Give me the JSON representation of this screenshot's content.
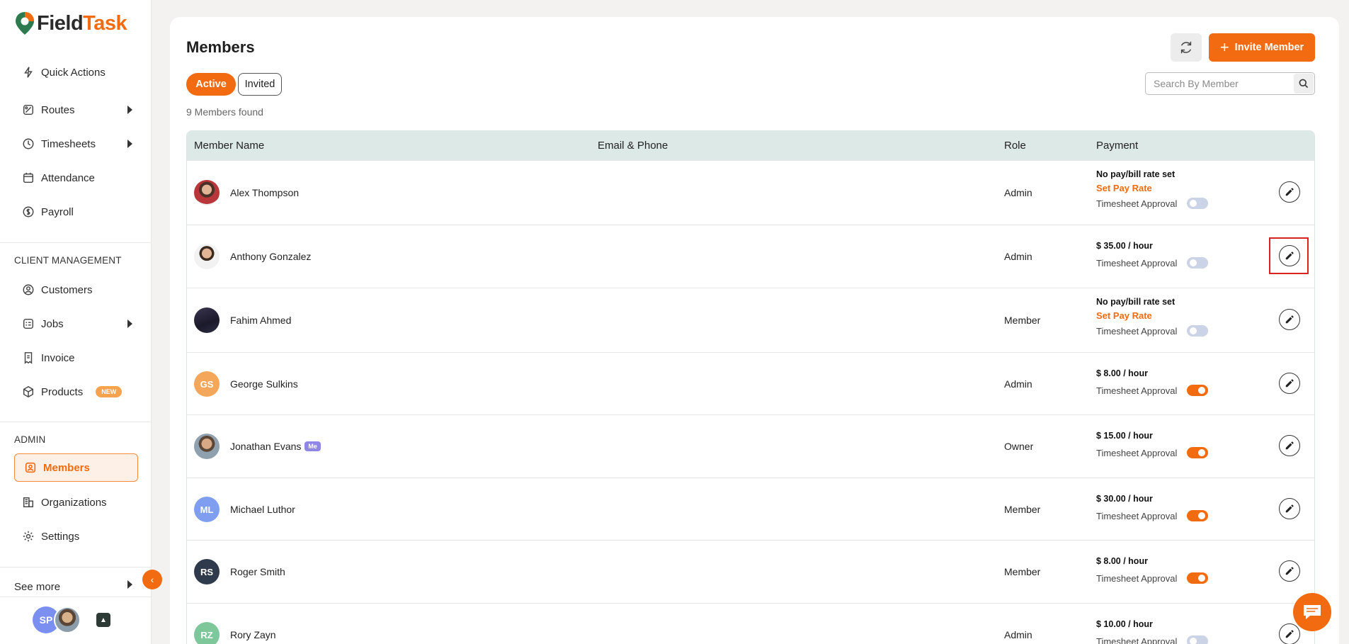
{
  "app": {
    "name_part1": "Field",
    "name_part2": "Task"
  },
  "sidebar": {
    "items": [
      {
        "label": "Quick Actions",
        "icon": "lightning-icon"
      },
      {
        "label": "Routes",
        "icon": "route-icon"
      },
      {
        "label": "Timesheets",
        "icon": "clock-icon"
      },
      {
        "label": "Attendance",
        "icon": "calendar-icon"
      },
      {
        "label": "Payroll",
        "icon": "dollar-icon"
      }
    ],
    "client_section": "CLIENT MANAGEMENT",
    "client_items": [
      {
        "label": "Customers",
        "icon": "user-circle-icon"
      },
      {
        "label": "Jobs",
        "icon": "jobs-icon"
      },
      {
        "label": "Invoice",
        "icon": "invoice-icon"
      },
      {
        "label": "Products",
        "icon": "box-icon",
        "badge": "NEW"
      }
    ],
    "admin_section": "ADMIN",
    "admin_items": [
      {
        "label": "Members",
        "icon": "member-icon",
        "active": true
      },
      {
        "label": "Organizations",
        "icon": "building-icon"
      },
      {
        "label": "Settings",
        "icon": "gear-icon"
      }
    ],
    "see_more": "See more",
    "user_initials": "SP"
  },
  "header": {
    "title": "Members",
    "invite_label": "Invite Member",
    "tabs": {
      "active": "Active",
      "invited": "Invited"
    },
    "count_text": "9 Members found",
    "search_placeholder": "Search By Member"
  },
  "table": {
    "columns": [
      "Member Name",
      "Email & Phone",
      "Role",
      "Payment"
    ],
    "timesheet_label": "Timesheet Approval",
    "no_rate_label": "No pay/bill rate set",
    "set_rate_label": "Set Pay Rate",
    "rows": [
      {
        "name": "Alex Thompson",
        "role": "Admin",
        "pay": null,
        "approval": false
      },
      {
        "name": "Anthony Gonzalez",
        "role": "Admin",
        "pay": "$ 35.00 / hour",
        "approval": false
      },
      {
        "name": "Fahim Ahmed",
        "role": "Member",
        "pay": null,
        "approval": false
      },
      {
        "name": "George Sulkins",
        "initials": "GS",
        "role": "Admin",
        "pay": "$ 8.00 / hour",
        "approval": true
      },
      {
        "name": "Jonathan Evans",
        "badge": "Me",
        "role": "Owner",
        "pay": "$ 15.00 / hour",
        "approval": true
      },
      {
        "name": "Michael Luthor",
        "initials": "ML",
        "role": "Member",
        "pay": "$ 30.00 / hour",
        "approval": true
      },
      {
        "name": "Roger Smith",
        "initials": "RS",
        "role": "Member",
        "pay": "$ 8.00 / hour",
        "approval": true
      },
      {
        "name": "Rory Zayn",
        "initials": "RZ",
        "role": "Admin",
        "pay": "$ 10.00 / hour",
        "approval": false
      }
    ]
  },
  "colors": {
    "accent": "#f26b10",
    "header_bg": "#dde9e6",
    "toggle_off": "#cbd3e6"
  }
}
